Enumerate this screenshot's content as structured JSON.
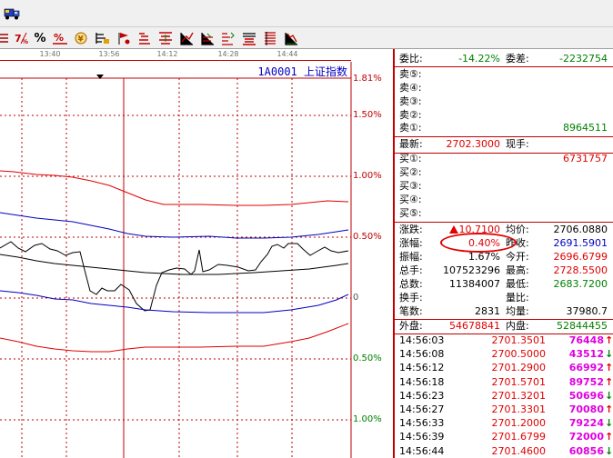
{
  "toolbar": {
    "pct_button_label": "%",
    "buttons": [
      "settings-icon",
      "pct-red-icon",
      "percent-icon",
      "pct-box-icon",
      "coin-icon",
      "bar-icon",
      "flag-icon",
      "fill-icon",
      "line-down-icon",
      "line-up-icon",
      "cross-line-icon",
      "dist-icon",
      "stack-icon",
      "chart-down-icon"
    ]
  },
  "chart": {
    "times": [
      "13:40",
      "13:56",
      "14:12",
      "14:28",
      "14:44"
    ],
    "code": "1A0001  上证指数",
    "pct_labels": [
      {
        "text": "1.81%",
        "color": "#c00000"
      },
      {
        "text": "1.50%",
        "color": "#c00000"
      },
      {
        "text": "1.00%",
        "color": "#c00000"
      },
      {
        "text": "0.50%",
        "color": "#c00000"
      },
      {
        "text": "0",
        "color": "#555555"
      },
      {
        "text": "0.50%",
        "color": "#008000"
      },
      {
        "text": "1.00%",
        "color": "#008000"
      }
    ]
  },
  "panel": {
    "weibi_label": "委比:",
    "weibi_value": "-14.22%",
    "weicha_label": "委差:",
    "weicha_value": "-2232754",
    "sell5": "卖⑤:",
    "sell4": "卖④:",
    "sell3": "卖③:",
    "sell2": "卖②:",
    "sell1": "卖①:",
    "sell1_value": "8964511",
    "latest_label": "最新:",
    "latest_value": "2702.3000",
    "xianshou_label": "现手:",
    "buy1": "买①:",
    "buy1_value": "6731757",
    "buy2": "买②:",
    "buy3": "买③:",
    "buy4": "买④:",
    "buy5": "买⑤:",
    "zhangdie_label": "涨跌:",
    "zhangdie_value": "10.7100",
    "junjia_label": "均价:",
    "junjia_value": "2706.0880",
    "zhangfu_label": "涨幅:",
    "zhangfu_value": "0.40%",
    "zuoshou_label": "昨收:",
    "zuoshou_value": "2691.5901",
    "zhenfu_label": "振幅:",
    "zhenfu_value": "1.67%",
    "jinkai_label": "今开:",
    "jinkai_value": "2696.6799",
    "zongshou_label": "总手:",
    "zongshou_value": "107523296",
    "zuigao_label": "最高:",
    "zuigao_value": "2728.5500",
    "zongshu_label": "总数:",
    "zongshu_value": "11384007",
    "zuidi_label": "最低:",
    "zuidi_value": "2683.7200",
    "huanshou_label": "换手:",
    "liangbi_label": "量比:",
    "bishu_label": "笔数:",
    "bishu_value": "2831",
    "junliang_label": "均量:",
    "junliang_value": "37980.7",
    "waipan_label": "外盘:",
    "waipan_value": "54678841",
    "neipan_label": "内盘:",
    "neipan_value": "52844455",
    "ticks": [
      {
        "time": "14:56:03",
        "price": "2701.3501",
        "vol": "76448",
        "dir": "up"
      },
      {
        "time": "14:56:08",
        "price": "2700.5000",
        "vol": "43512",
        "dir": "down"
      },
      {
        "time": "14:56:12",
        "price": "2701.2900",
        "vol": "66992",
        "dir": "up"
      },
      {
        "time": "14:56:18",
        "price": "2701.5701",
        "vol": "89752",
        "dir": "up"
      },
      {
        "time": "14:56:23",
        "price": "2701.3201",
        "vol": "50696",
        "dir": "down"
      },
      {
        "time": "14:56:27",
        "price": "2701.3301",
        "vol": "70080",
        "dir": "up"
      },
      {
        "time": "14:56:33",
        "price": "2701.2000",
        "vol": "79224",
        "dir": "down"
      },
      {
        "time": "14:56:39",
        "price": "2701.6799",
        "vol": "72000",
        "dir": "up"
      },
      {
        "time": "14:56:44",
        "price": "2701.4600",
        "vol": "60856",
        "dir": "down"
      }
    ]
  }
}
